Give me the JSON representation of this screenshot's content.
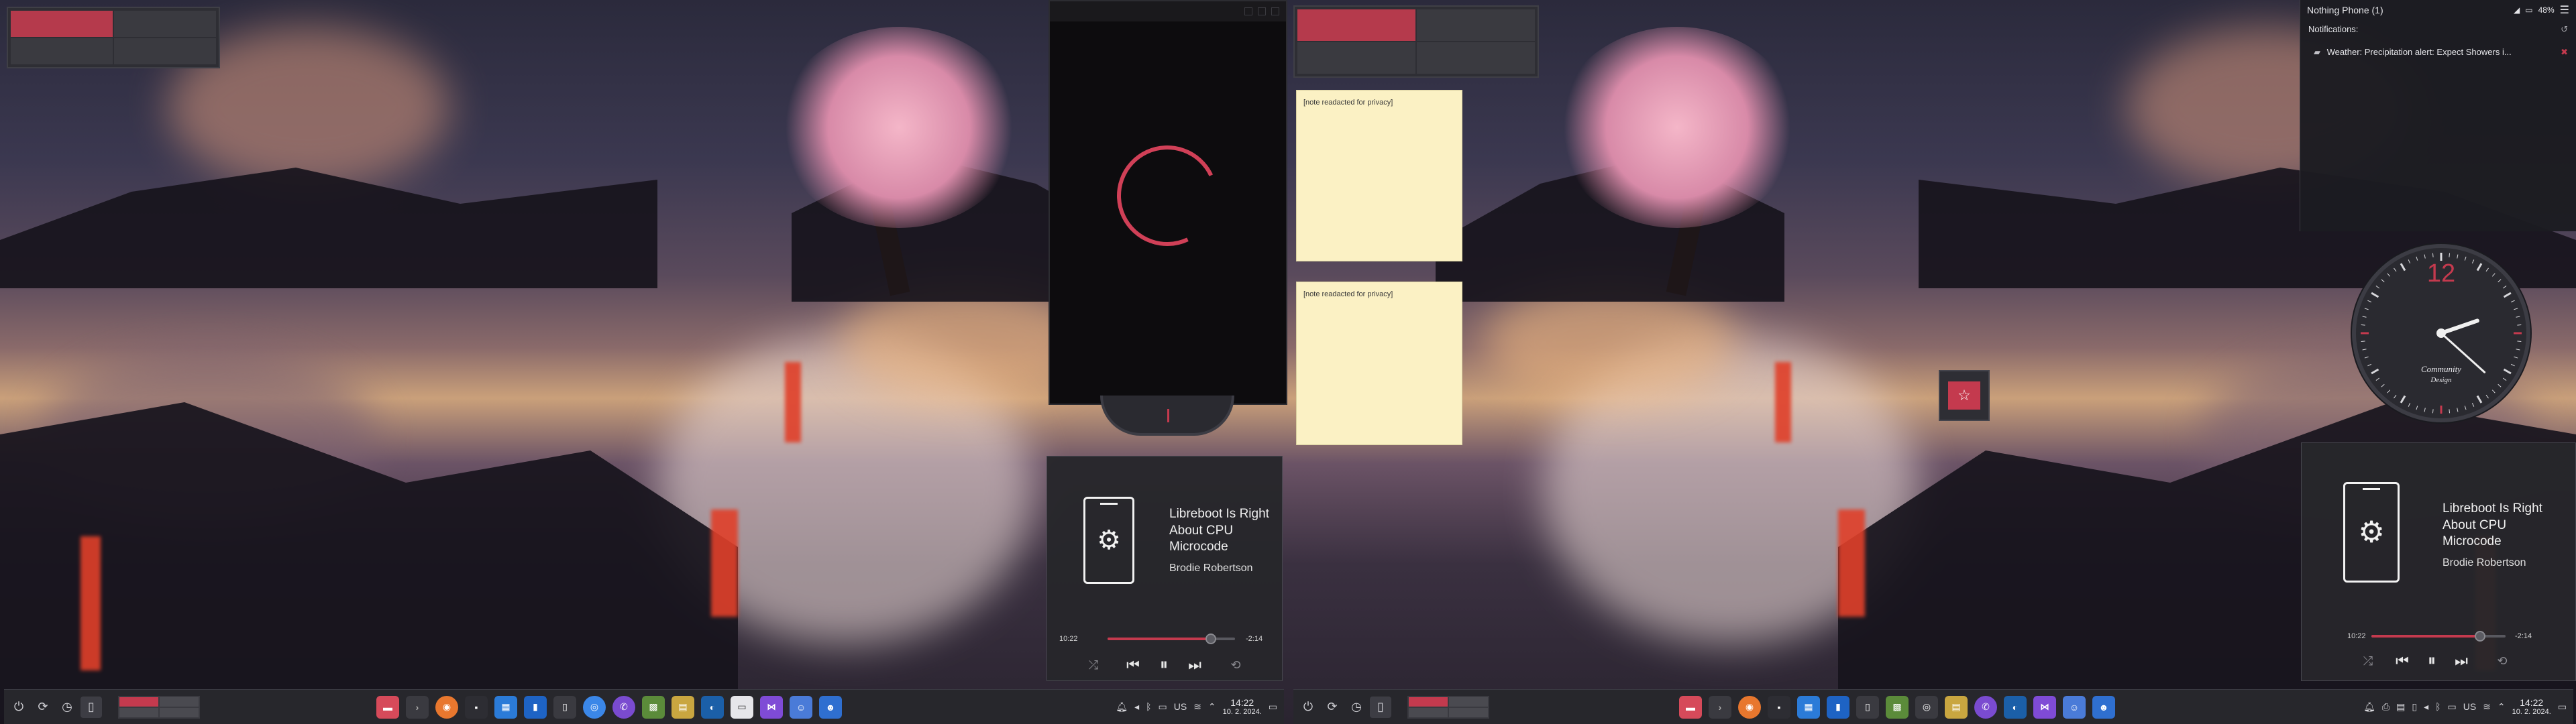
{
  "left_screen": {
    "note_top": {
      "text": "[note readacted for privacy]"
    },
    "note_bottom": {
      "text": "[note readacted for privacy]"
    },
    "media": {
      "title": "Libreboot Is Right About CPU Microcode",
      "artist": "Brodie Robertson",
      "elapsed": "10:22",
      "remaining": "-2:14",
      "progress": 0.81
    },
    "taskbar": {
      "keyboard_layout": "US",
      "time": "14:22",
      "date": "10. 2. 2024."
    }
  },
  "right_screen": {
    "notifications": {
      "device": "Nothing Phone (1)",
      "battery": "48%",
      "label": "Notifications:",
      "item": "Weather: Precipitation alert: Expect Showers i..."
    },
    "clock": {
      "twelve": "12",
      "brand_line1": "Community",
      "brand_line2": "Design",
      "hour": 2,
      "minute": 22
    },
    "media": {
      "title": "Libreboot Is Right About CPU Microcode",
      "artist": "Brodie Robertson",
      "elapsed": "10:22",
      "remaining": "-2:14",
      "progress": 0.81
    },
    "taskbar": {
      "keyboard_layout": "US",
      "time": "14:22",
      "date": "10. 2. 2024."
    }
  },
  "colors": {
    "accent": "#c43a4e",
    "panel": "#27272c",
    "note": "#fbf1c4"
  },
  "taskbar_icons": [
    "app-launcher-icon",
    "refresh-icon",
    "back-icon",
    "phone-icon",
    "folder-red-icon",
    "arrow-icon",
    "firefox-icon",
    "terminal-icon",
    "calendar-icon",
    "kdeconnect-icon",
    "phone-small-icon",
    "chromium-icon",
    "viber-icon",
    "minecraft-icon",
    "archive-icon",
    "steam-icon",
    "document-icon",
    "visual-studio-icon",
    "discord-icon",
    "bot-icon"
  ]
}
